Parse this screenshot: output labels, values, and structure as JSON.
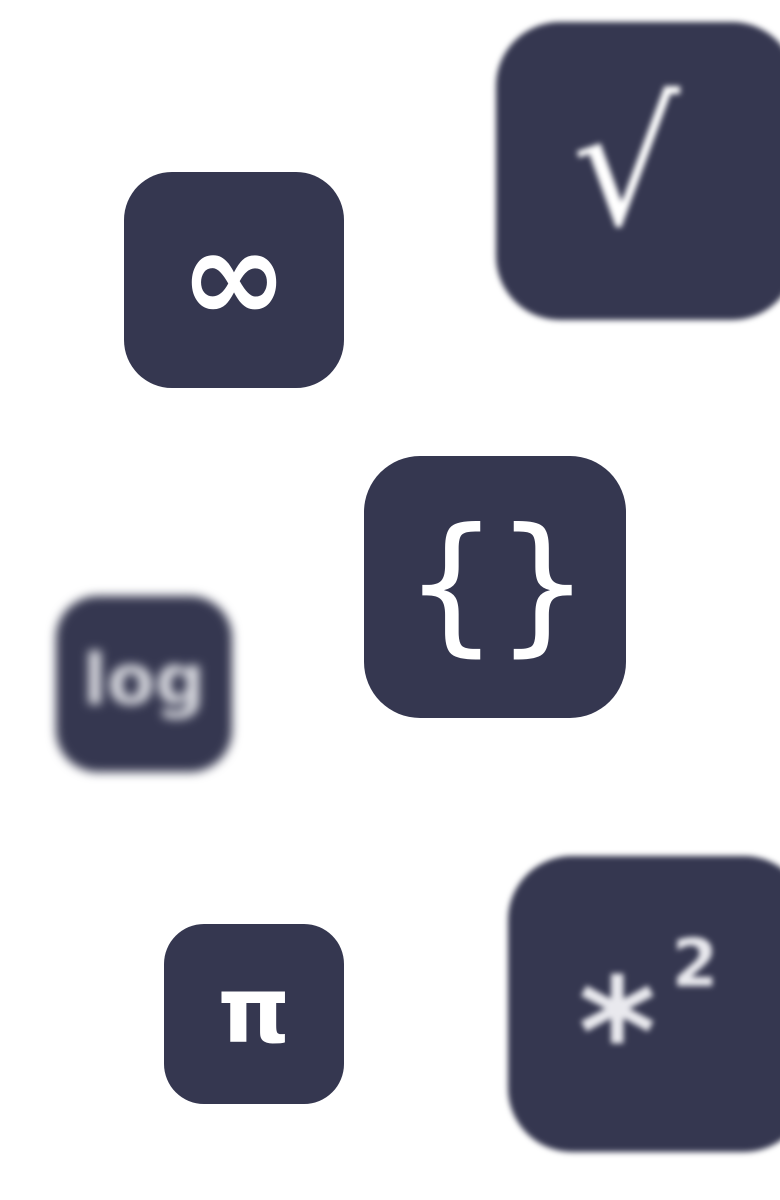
{
  "tiles": {
    "infinity": {
      "glyph": "∞"
    },
    "sqrt": {
      "glyph": "√"
    },
    "braces": {
      "glyph": "{}"
    },
    "log": {
      "glyph": "log"
    },
    "pi": {
      "glyph": "π"
    },
    "star_squared": {
      "glyph": "*",
      "superscript": "2"
    }
  },
  "colors": {
    "background": "#ffffff",
    "tile": "#353750",
    "glyph": "#ffffff"
  }
}
